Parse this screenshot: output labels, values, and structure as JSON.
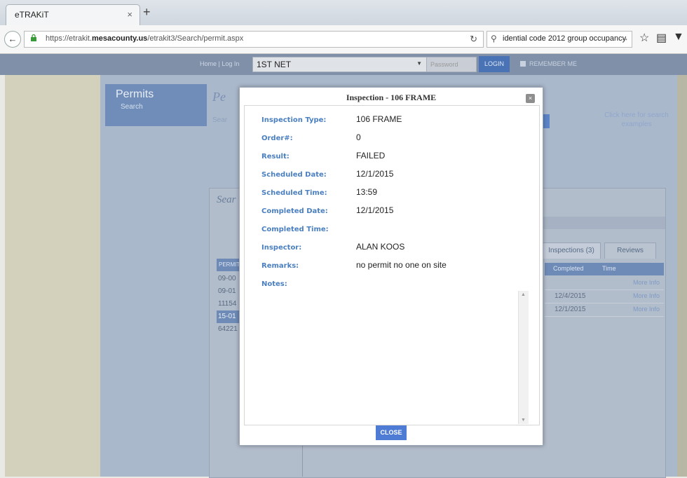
{
  "browser": {
    "tab_title": "eTRAKiT",
    "tab_close": "×",
    "new_tab": "+",
    "url_prefix": "https://etrakit.",
    "url_domain": "mesacounty.us",
    "url_path": "/etrakit3/Search/permit.aspx",
    "search_text": "idential code 2012 group occupancy"
  },
  "login_bar": {
    "home": "Home | Log In",
    "account": "1ST NET",
    "password_placeholder": "Password",
    "login": "LOGIN",
    "remember": "REMEMBER ME"
  },
  "page": {
    "permits_title": "Permits",
    "permits_sub": "Search",
    "pe_title": "Pe",
    "sear_small": "Sear",
    "click_here": "Click here for search examples",
    "search_title": "Sear",
    "tabs": [
      "Inspections (3)",
      "Reviews"
    ],
    "permit_header": "PERMIT",
    "permits": [
      "09-00",
      "09-01",
      "11154",
      "15-01",
      "64221"
    ],
    "table_headers": [
      "Completed",
      "Time"
    ],
    "rows": [
      {
        "date": "",
        "more": "More Info"
      },
      {
        "date": "12/4/2015",
        "more": "More Info"
      },
      {
        "date": "12/1/2015",
        "more": "More Info"
      }
    ]
  },
  "modal": {
    "title": "Inspection - 106 FRAME",
    "close_x": "×",
    "fields": [
      {
        "label": "Inspection Type:",
        "value": "106 FRAME"
      },
      {
        "label": "Order#:",
        "value": "0"
      },
      {
        "label": "Result:",
        "value": "FAILED"
      },
      {
        "label": "Scheduled Date:",
        "value": "12/1/2015"
      },
      {
        "label": "Scheduled Time:",
        "value": "13:59"
      },
      {
        "label": "Completed Date:",
        "value": "12/1/2015"
      },
      {
        "label": "Completed Time:",
        "value": ""
      },
      {
        "label": "Inspector:",
        "value": "ALAN KOOS"
      },
      {
        "label": "Remarks:",
        "value": "no permit no one on site"
      },
      {
        "label": "Notes:",
        "value": ""
      }
    ],
    "close_button": "CLOSE"
  }
}
